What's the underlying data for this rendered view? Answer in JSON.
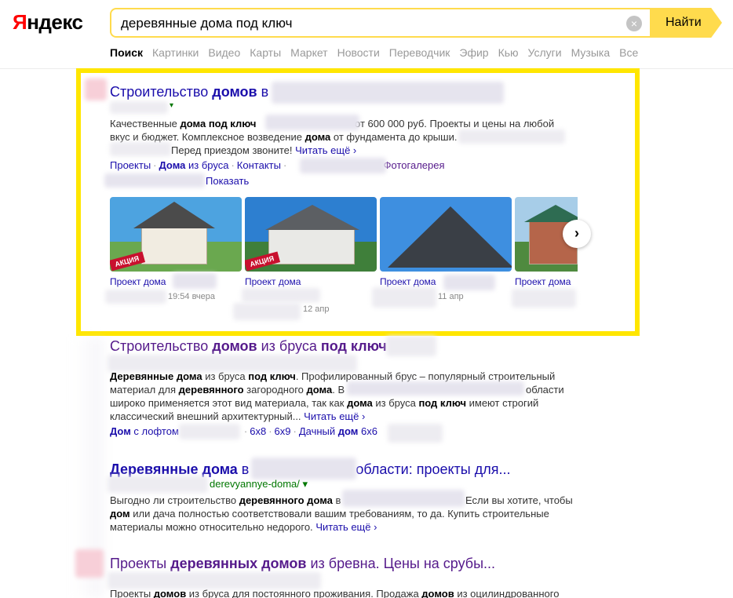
{
  "header": {
    "logo_first": "Я",
    "logo_rest": "ндекс",
    "search_value": "деревянные дома под ключ",
    "clear_icon": "×",
    "find_label": "Найти"
  },
  "nav": [
    "Поиск",
    "Картинки",
    "Видео",
    "Карты",
    "Маркет",
    "Новости",
    "Переводчик",
    "Эфир",
    "Кью",
    "Услуги",
    "Музыка",
    "Все"
  ],
  "result1": {
    "title_a": "Строительство ",
    "title_b": "домов",
    "title_c": " в",
    "url_arrow": "▾",
    "snippet_a": "Качественные ",
    "snippet_b": "дома под ключ",
    "snippet_c": " от 600 000 руб. Проекты и цены на любой вкус и бюджет. Комплексное возведение ",
    "snippet_d": "дома",
    "snippet_e": " от фундамента до крыши.",
    "snippet_f": "Перед приездом звоните!",
    "read_more": "Читать ещё ›",
    "sitelinks": {
      "s1": "Проекты",
      "s2a": "Дома",
      "s2b": " из бруса",
      "s3": "Контакты",
      "s4": "Фотогалерея"
    },
    "show_label": "Показать",
    "gallery": [
      {
        "caption": "Проект дома",
        "date": "19:54 вчера",
        "badge": "АКЦИЯ"
      },
      {
        "caption": "Проект дома",
        "date": "12 апр",
        "badge": "АКЦИЯ"
      },
      {
        "caption": "Проект дома",
        "date": "11 апр",
        "badge": ""
      },
      {
        "caption": "Проект дома",
        "date": "",
        "badge": ""
      }
    ],
    "next_icon": "›"
  },
  "result2": {
    "title_a": "Строительство ",
    "title_b": "домов",
    "title_c": " из бруса ",
    "title_d": "под ключ",
    "snippet_1a": "Деревянные дома",
    "snippet_1b": " из бруса ",
    "snippet_1c": "под ключ",
    "snippet_1d": ". Профилированный брус – популярный строительный",
    "snippet_2a": "материал для ",
    "snippet_2b": "деревянного",
    "snippet_2c": " загородного ",
    "snippet_2d": "дома",
    "snippet_2e": ". В",
    "snippet_2f": "области",
    "snippet_3a": "широко применяется этот вид материала, так как ",
    "snippet_3b": "дома",
    "snippet_3c": " из бруса ",
    "snippet_3d": "под ключ",
    "snippet_3e": " имеют строгий",
    "snippet_4a": "классический внешний архитектурный...",
    "read_more": "Читать ещё ›",
    "sl1a": "Дом",
    "sl1b": " с лофтом",
    "sl2": "6х8",
    "sl3": "6х9",
    "sl4a": "Дачный ",
    "sl4b": "дом",
    "sl4c": " 6х6"
  },
  "result3": {
    "title_a": "Деревянные дома",
    "title_b": " в",
    "title_c": "области: проекты для...",
    "url": "derevyannye-doma/ ▾",
    "snippet_1a": "Выгодно ли строительство ",
    "snippet_1b": "деревянного дома",
    "snippet_1c": " в",
    "snippet_1d": "Если вы хотите, чтобы",
    "snippet_2a": "дом",
    "snippet_2b": " или дача полностью соответствовали вашим требованиям, то да. Купить строительные",
    "snippet_3a": "материалы можно относительно недорого.",
    "read_more": "Читать ещё ›"
  },
  "result4": {
    "title_a": "Проекты ",
    "title_b": "деревянных домов",
    "title_c": " из бревна. Цены на срубы...",
    "snippet_a": "Проекты ",
    "snippet_b": "домов",
    "snippet_c": " из бруса для постоянного проживания. Продажа ",
    "snippet_d": "домов",
    "snippet_e": " из оцилиндрованного"
  },
  "colors": {
    "brand_red": "#ff0000",
    "accent_yellow": "#ffdb4d",
    "highlight_yellow": "#ffe600",
    "link_blue": "#1a0dab",
    "visited_purple": "#551a8b"
  }
}
